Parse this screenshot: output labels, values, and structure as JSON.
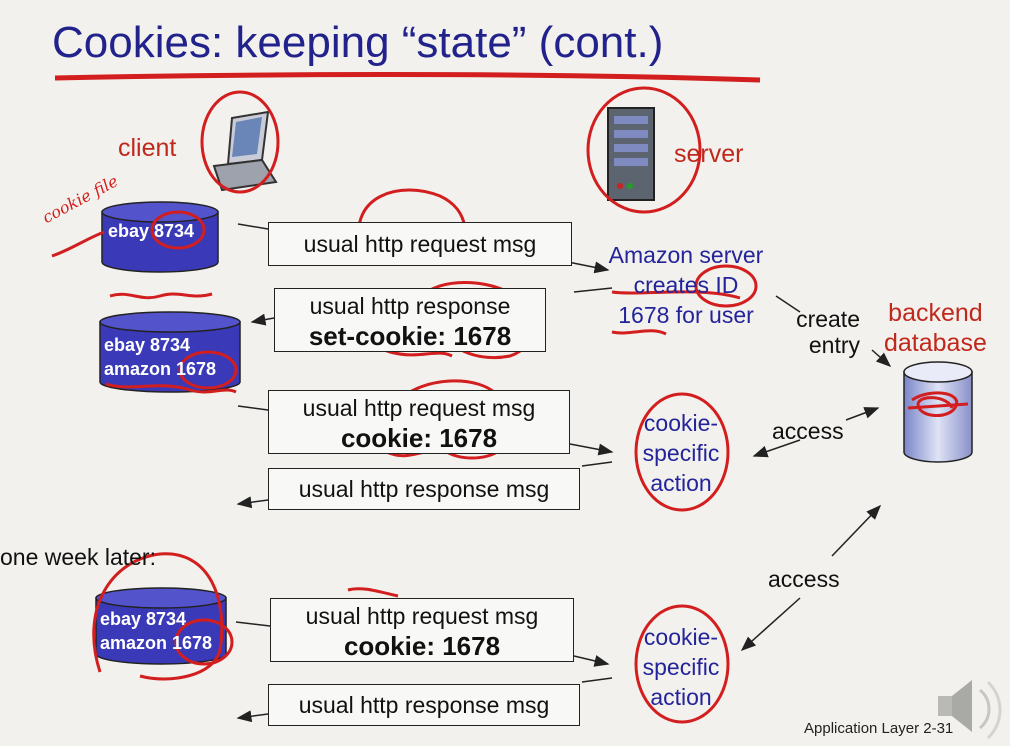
{
  "slide": {
    "title": "Cookies: keeping “state” (cont.)",
    "footer": "Application Layer 2-31"
  },
  "roles": {
    "client": "client",
    "server": "server",
    "backend": [
      "backend",
      "database"
    ],
    "one_week_later": "one week later:"
  },
  "cookie_files": {
    "handwritten_note": "cookie file",
    "disk1": [
      "ebay 8734"
    ],
    "disk2": [
      "ebay 8734",
      "amazon 1678"
    ],
    "disk3": [
      "ebay 8734",
      "amazon 1678"
    ]
  },
  "messages": {
    "m1": [
      "usual http request msg"
    ],
    "m2": [
      "usual http response",
      "set-cookie: 1678"
    ],
    "m3": [
      "usual http request msg",
      "cookie: 1678"
    ],
    "m4": [
      "usual http response msg"
    ],
    "m5": [
      "usual http request msg",
      "cookie: 1678"
    ],
    "m6": [
      "usual http response msg"
    ]
  },
  "server_notes": {
    "amazon": [
      "Amazon server",
      "creates ID",
      "1678 for user"
    ],
    "create_entry": [
      "create",
      "entry"
    ],
    "access1": "access",
    "access2": "access",
    "action1": [
      "cookie-",
      "specific",
      "action"
    ],
    "action2": [
      "cookie-",
      "specific",
      "action"
    ]
  },
  "colors": {
    "title_blue": "#22228c",
    "disk_blue": "#3a3ab8",
    "annotation_red": "#d21e1e",
    "label_red": "#c0281c"
  },
  "icons": [
    "laptop-icon",
    "server-icon",
    "speaker-icon",
    "database-icon"
  ]
}
